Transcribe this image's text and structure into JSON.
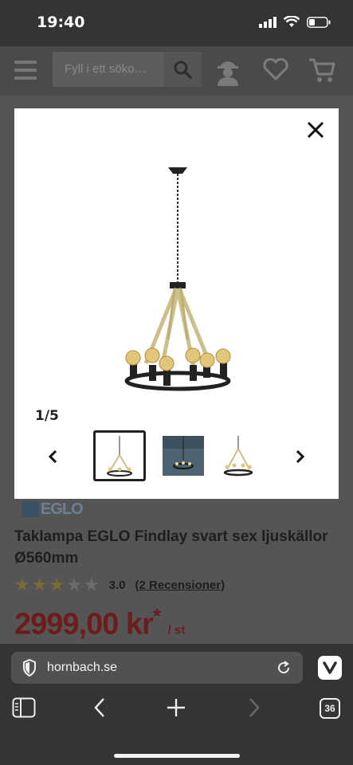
{
  "status": {
    "time": "19:40"
  },
  "header": {
    "search_placeholder": "Fyll i ett söko…"
  },
  "modal": {
    "counter": "1/5",
    "thumbnails": [
      "thumb-1",
      "thumb-2",
      "thumb-3"
    ],
    "active_thumb": 0
  },
  "product": {
    "brand": "EGLO",
    "title": "Taklampa EGLO Findlay svart sex ljuskällor Ø560mm",
    "rating_value": "3.0",
    "rating_stars": 3,
    "rating_max": 5,
    "reviews": "(2 Recensioner)",
    "price": "2999,00 kr",
    "price_mark": "*",
    "price_unit": "/ st"
  },
  "browser": {
    "url": "hornbach.se",
    "tab_count": "36"
  },
  "colors": {
    "price": "#6d1c1c",
    "star_on": "#7a6b32",
    "modal_bg": "#ffffff"
  }
}
